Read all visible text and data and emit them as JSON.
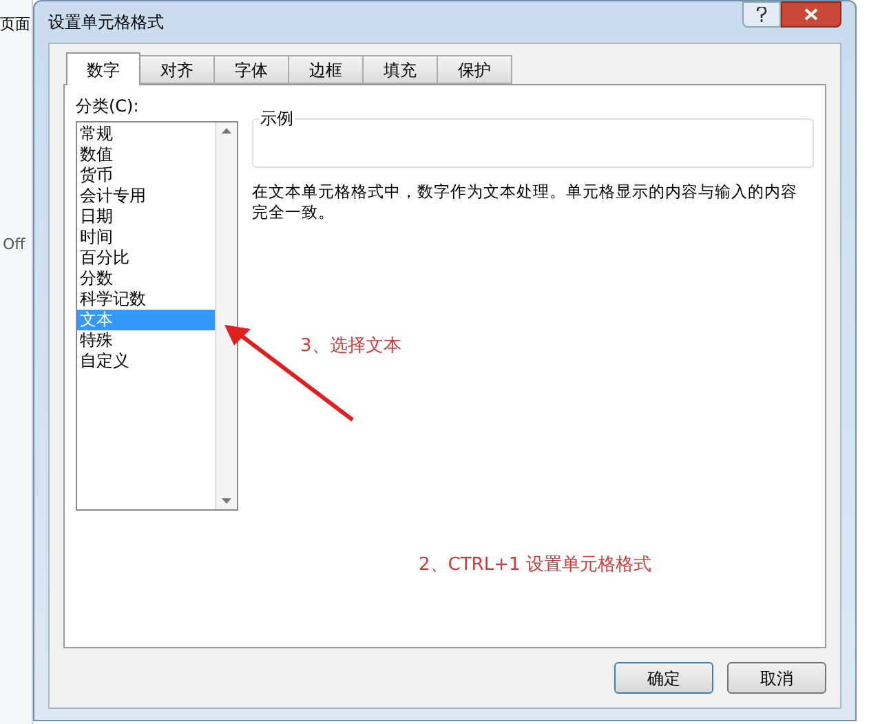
{
  "background": {
    "texts": [
      "页面",
      "Off"
    ]
  },
  "dialog": {
    "title": "设置单元格格式",
    "tabs": [
      {
        "label": "数字",
        "selected": true
      },
      {
        "label": "对齐",
        "selected": false
      },
      {
        "label": "字体",
        "selected": false
      },
      {
        "label": "边框",
        "selected": false
      },
      {
        "label": "填充",
        "selected": false
      },
      {
        "label": "保护",
        "selected": false
      }
    ],
    "category_label": "分类(C):",
    "categories": [
      {
        "label": "常规",
        "selected": false
      },
      {
        "label": "数值",
        "selected": false
      },
      {
        "label": "货币",
        "selected": false
      },
      {
        "label": "会计专用",
        "selected": false
      },
      {
        "label": "日期",
        "selected": false
      },
      {
        "label": "时间",
        "selected": false
      },
      {
        "label": "百分比",
        "selected": false
      },
      {
        "label": "分数",
        "selected": false
      },
      {
        "label": "科学记数",
        "selected": false
      },
      {
        "label": "文本",
        "selected": true
      },
      {
        "label": "特殊",
        "selected": false
      },
      {
        "label": "自定义",
        "selected": false
      }
    ],
    "sample_label": "示例",
    "description": "在文本单元格格式中，数字作为文本处理。单元格显示的内容与输入的内容完全一致。",
    "buttons": [
      "确定",
      "取消"
    ]
  },
  "annotations": [
    "3、选择文本",
    "2、CTRL+1 设置单元格格式"
  ]
}
